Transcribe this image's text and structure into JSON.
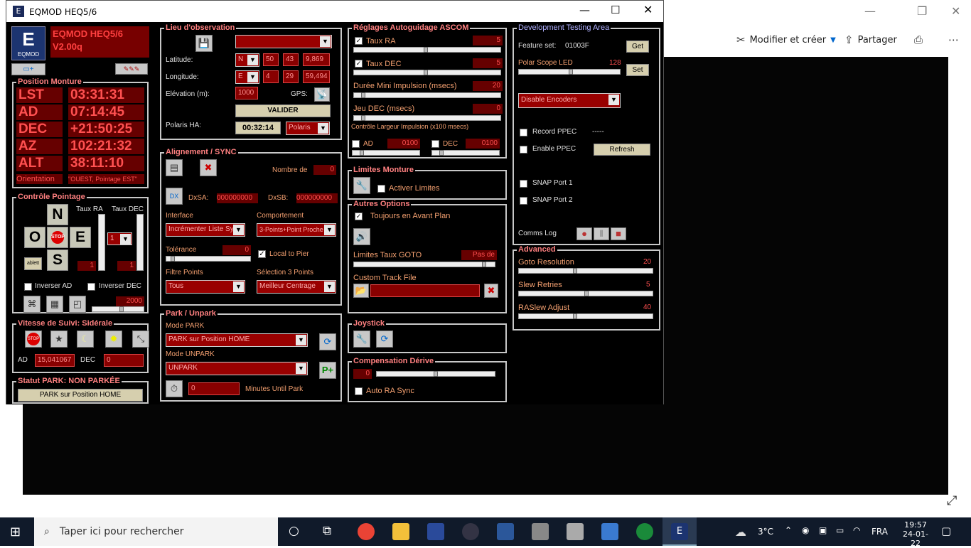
{
  "photos": {
    "edit_label": "Modifier et créer",
    "share_label": "Partager"
  },
  "window": {
    "title": "EQMOD HEQ5/6"
  },
  "header": {
    "brand_line1": "EQMOD  HEQ5/6",
    "brand_line2": "V2.00q",
    "logo_text": "EQMOD"
  },
  "position": {
    "title": "Position Monture",
    "rows": [
      {
        "label": "LST",
        "value": "03:31:31"
      },
      {
        "label": "AD",
        "value": "07:14:45"
      },
      {
        "label": "DEC",
        "value": "+21:50:25"
      },
      {
        "label": "AZ",
        "value": "102:21:32"
      },
      {
        "label": "ALT",
        "value": "38:11:10"
      }
    ],
    "orientation_label": "Orientation",
    "orientation_value": "\"OUEST, Pointage EST\""
  },
  "pointage": {
    "title": "Contrôle Pointage",
    "rate_ra_label": "Taux RA",
    "rate_dec_label": "Taux DEC",
    "n": "N",
    "o": "O",
    "e": "E",
    "s": "S",
    "stop": "STOP",
    "ablett": "ablett",
    "rate_select": "1",
    "ra_val": "1",
    "dec_val": "1",
    "inv_ad": "Inverser AD",
    "inv_dec": "Inverser DEC",
    "slider_val": "2000"
  },
  "tracking": {
    "title": "Vitesse de Suivi: Sidérale",
    "ad_label": "AD",
    "ad_value": "15,041067",
    "dec_label": "DEC",
    "dec_value": "0",
    "stop": "STOP"
  },
  "park_status": {
    "title": "Statut PARK: NON PARKÉE",
    "button": "PARK sur Position HOME"
  },
  "lieu": {
    "title": "Lieu d'observation",
    "lat_label": "Latitude:",
    "lat": [
      "N",
      "50",
      "43",
      "9,869"
    ],
    "lon_label": "Longitude:",
    "lon": [
      "E",
      "4",
      "29",
      "59,494"
    ],
    "elev_label": "Elévation (m):",
    "elev": "1000",
    "gps_label": "GPS:",
    "validate": "VALIDER",
    "polaris_label": "Polaris HA:",
    "polaris_ha": "00:32:14",
    "polaris_sel": "Polaris"
  },
  "align": {
    "title": "Alignement / SYNC",
    "count_label": "Nombre de",
    "count": "0",
    "dxsa_label": "DxSA:",
    "dxsa": "000000000",
    "dxsb_label": "DxSB:",
    "dxsb": "000000000",
    "interface_label": "Interface",
    "interface": "Incrémenter Liste Syn",
    "behavior_label": "Comportement",
    "behavior": "3-Points+Point Proche",
    "tolerance_label": "Tolérance",
    "tolerance": "0",
    "local_pier": "Local to Pier",
    "filter_label": "Filtre Points",
    "filter": "Tous",
    "select3_label": "Sélection 3 Points",
    "select3": "Meilleur Centrage"
  },
  "park": {
    "title": "Park / Unpark",
    "mode_park_label": "Mode PARK",
    "mode_park": "PARK sur Position HOME",
    "mode_unpark_label": "Mode UNPARK",
    "mode_unpark": "UNPARK",
    "minutes": "0",
    "minutes_label": "Minutes Until Park"
  },
  "ascom": {
    "title": "Réglages Autoguidage ASCOM",
    "rate_ra": "Taux RA",
    "rate_ra_val": "5",
    "rate_dec": "Taux DEC",
    "rate_dec_val": "5",
    "min_pulse": "Durée Mini Impulsion (msecs)",
    "min_pulse_val": "20",
    "dec_backlash": "Jeu DEC (msecs)",
    "dec_backlash_val": "0",
    "pulse_width": "Contrôle Largeur Impulsion (x100 msecs)",
    "ad": "AD",
    "ad_val": "0100",
    "dec": "DEC",
    "dec_val": "0100"
  },
  "limits": {
    "title": "Limites Monture",
    "activate": "Activer Limites"
  },
  "other": {
    "title": "Autres Options",
    "always_on_top": "Toujours en Avant Plan",
    "goto_limit": "Limites Taux GOTO",
    "goto_limit_val": "Pas de",
    "custom_track": "Custom Track File"
  },
  "joystick": {
    "title": "Joystick"
  },
  "drift": {
    "title": "Compensation Dérive",
    "value": "0",
    "auto_ra": "Auto RA Sync"
  },
  "dev": {
    "title": "Development Testing Area",
    "feature_label": "Feature set:",
    "feature": "01003F",
    "get": "Get",
    "polar_led": "Polar Scope LED",
    "polar_led_val": "128",
    "set": "Set",
    "encoders": "Disable Encoders",
    "record_ppec": "Record PPEC",
    "record_ppec_val": "-----",
    "enable_ppec": "Enable PPEC",
    "refresh": "Refresh",
    "snap1": "SNAP Port 1",
    "snap2": "SNAP Port 2",
    "comms": "Comms Log"
  },
  "advanced": {
    "title": "Advanced",
    "goto_res": "Goto Resolution",
    "goto_res_val": "20",
    "slew_retries": "Slew Retries",
    "slew_retries_val": "5",
    "raslew": "RASlew Adjust",
    "raslew_val": "40"
  },
  "taskbar": {
    "search": "Taper ici pour rechercher",
    "weather": "3°C",
    "lang": "FRA",
    "time": "19:57",
    "date": "24-01-22"
  }
}
